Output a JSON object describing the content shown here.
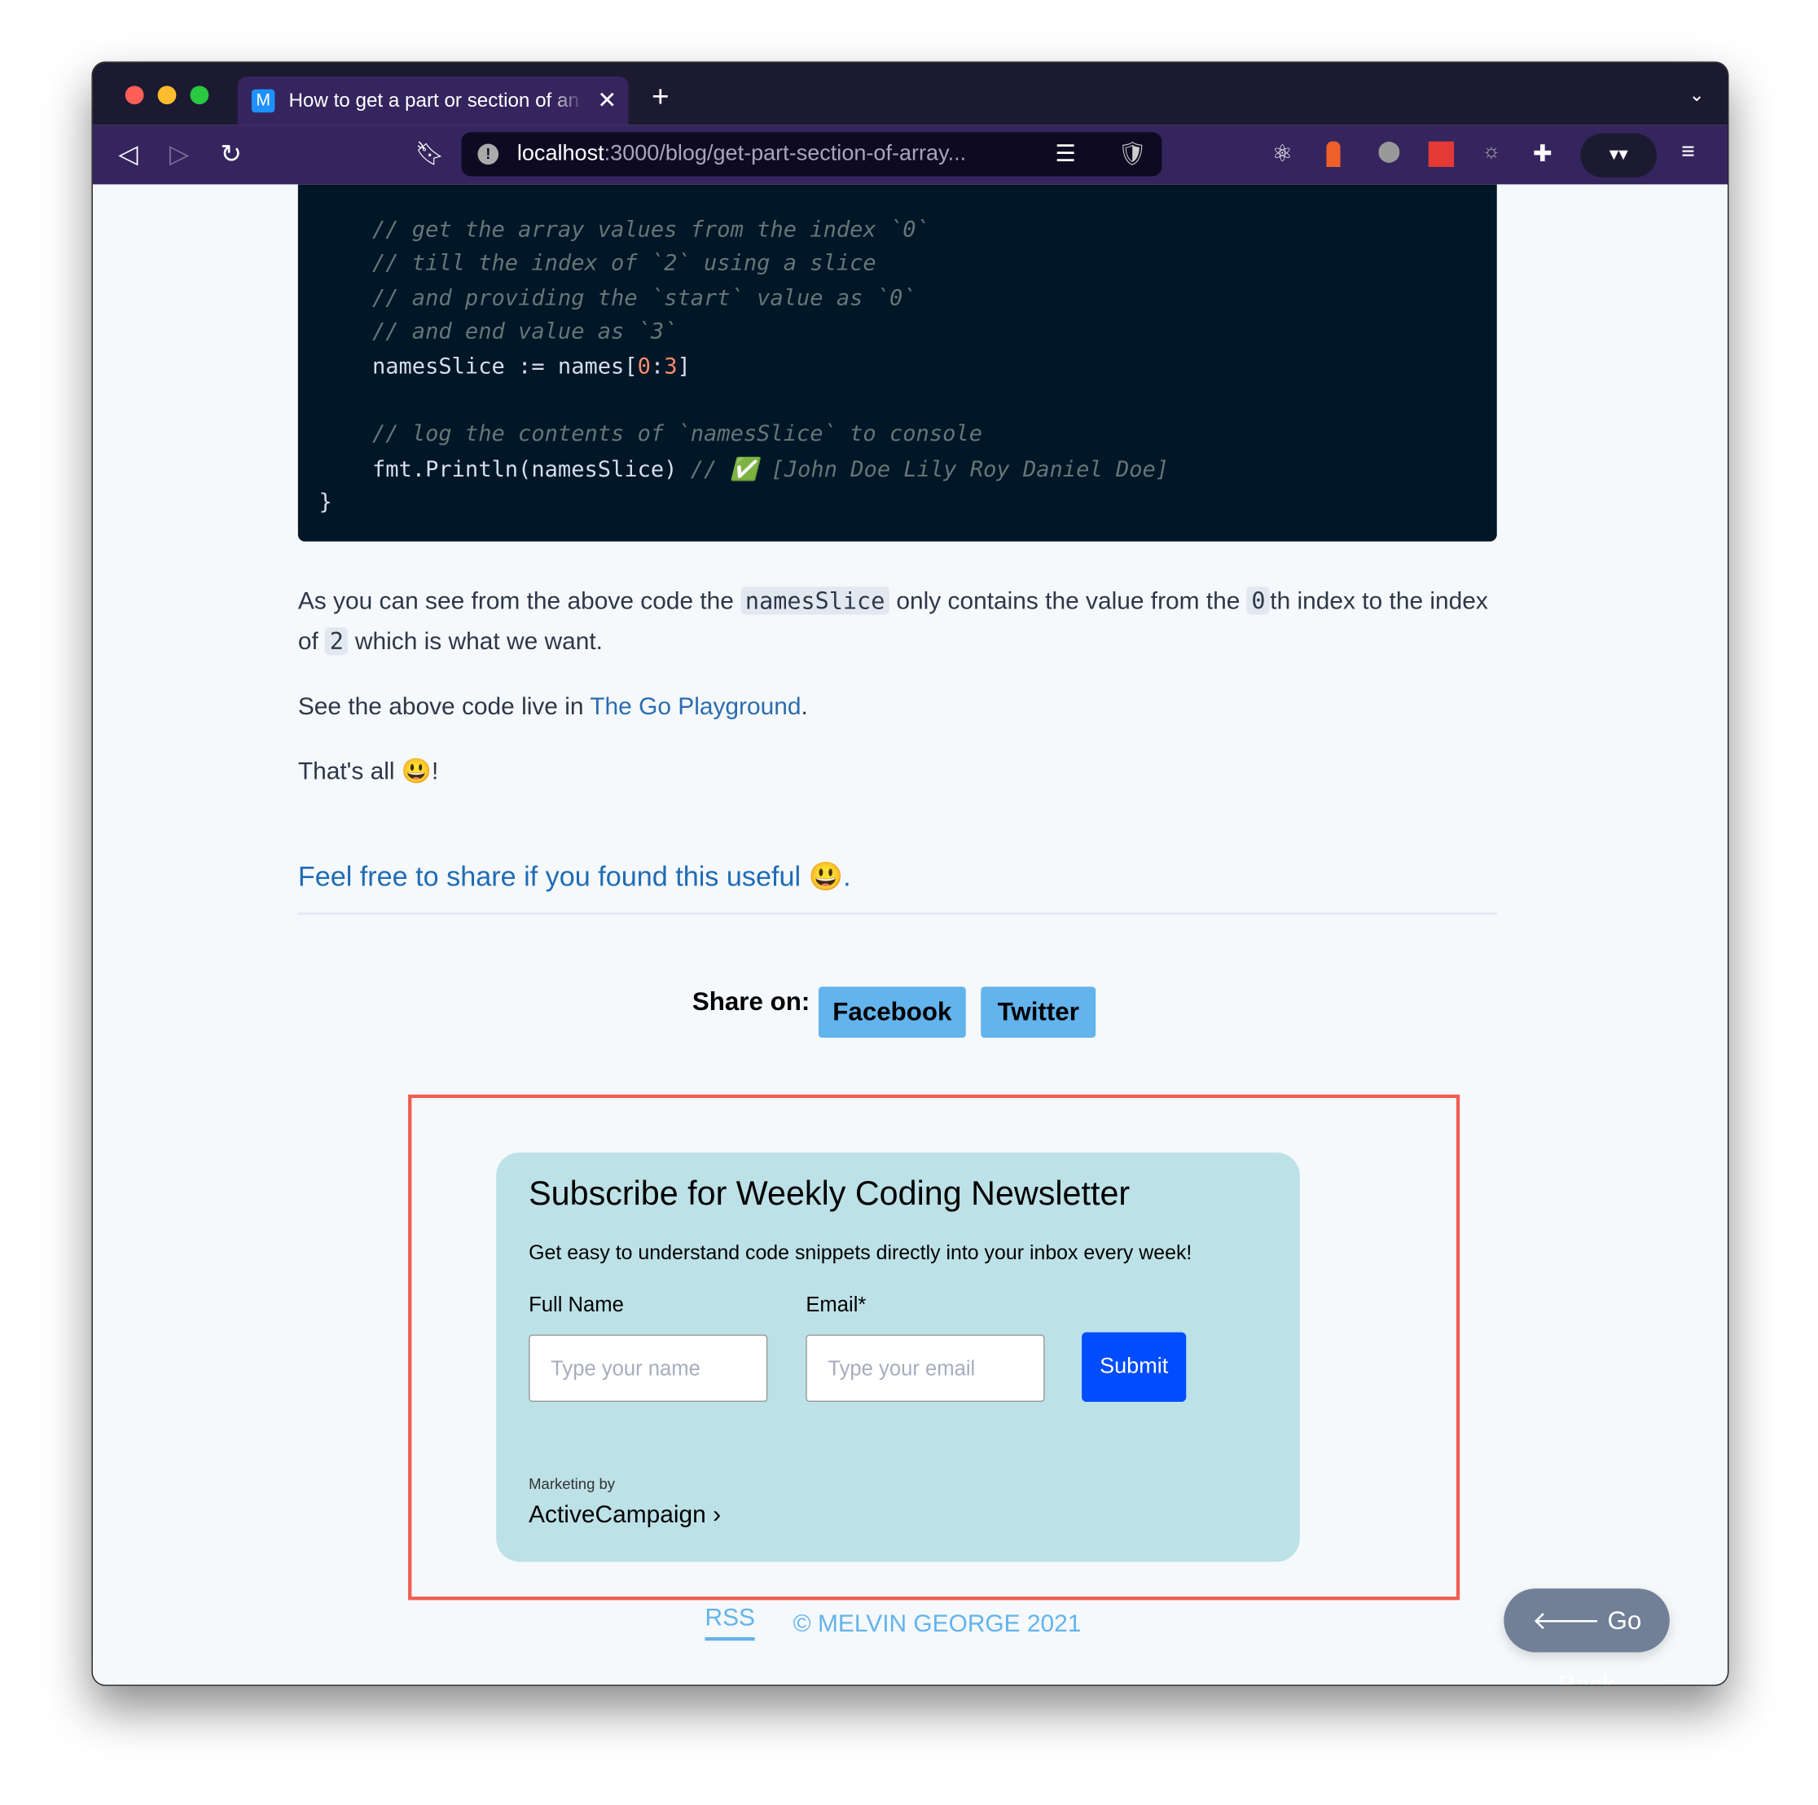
{
  "browser": {
    "tab_title": "How to get a part or section of an array",
    "tab_favicon": "M",
    "url_host": "localhost",
    "url_path": ":3000/blog/get-part-section-of-array...",
    "traffic_lights": [
      "#fe5f57",
      "#febc2e",
      "#28c840"
    ]
  },
  "code": {
    "lines": [
      {
        "indent": true,
        "parts": [
          {
            "t": "// get the array values from the index `0`",
            "c": "cm"
          }
        ]
      },
      {
        "indent": true,
        "parts": [
          {
            "t": "// till the index of `2` using a slice",
            "c": "cm"
          }
        ]
      },
      {
        "indent": true,
        "parts": [
          {
            "t": "// and providing the `start` value as `0`",
            "c": "cm"
          }
        ]
      },
      {
        "indent": true,
        "parts": [
          {
            "t": "// and end value as `3`",
            "c": "cm"
          }
        ]
      },
      {
        "indent": true,
        "parts": [
          {
            "t": "namesSlice := names[",
            "c": ""
          },
          {
            "t": "0",
            "c": "nm"
          },
          {
            "t": ":",
            "c": ""
          },
          {
            "t": "3",
            "c": "nm"
          },
          {
            "t": "]",
            "c": ""
          }
        ]
      },
      {
        "indent": false,
        "parts": []
      },
      {
        "indent": true,
        "parts": [
          {
            "t": "// log the contents of `namesSlice` to console",
            "c": "cm"
          }
        ]
      },
      {
        "indent": true,
        "parts": [
          {
            "t": "fmt.Println(namesSlice) ",
            "c": ""
          },
          {
            "t": "// ✅ [John Doe Lily Roy Daniel Doe]",
            "c": "cm"
          }
        ]
      },
      {
        "indent": false,
        "parts": [
          {
            "t": "}",
            "c": ""
          }
        ]
      }
    ]
  },
  "article": {
    "p1_a": "As you can see from the above code the ",
    "p1_code1": "namesSlice",
    "p1_b": " only contains the value from the ",
    "p1_code2": "0",
    "p1_c": "th index to the index of ",
    "p1_code3": "2",
    "p1_d": " which is what we want.",
    "p2_a": "See the above code live in ",
    "p2_link": "The Go Playground",
    "p2_b": ".",
    "p3": "That's all 😃!",
    "share_lead": "Feel free to share if you found this useful 😃."
  },
  "share": {
    "label": "Share on:",
    "facebook": "Facebook",
    "twitter": "Twitter"
  },
  "newsletter": {
    "title": "Subscribe for Weekly Coding Newsletter",
    "subtitle": "Get easy to understand code snippets directly into your inbox every week!",
    "name_label": "Full Name",
    "name_placeholder": "Type your name",
    "email_label": "Email*",
    "email_placeholder": "Type your email",
    "submit": "Submit",
    "marketing_by": "Marketing by",
    "brand": "ActiveCampaign ›"
  },
  "footer": {
    "rss": "RSS",
    "copyright": "© MELVIN GEORGE 2021",
    "go_back": "🡐 Go Back"
  }
}
